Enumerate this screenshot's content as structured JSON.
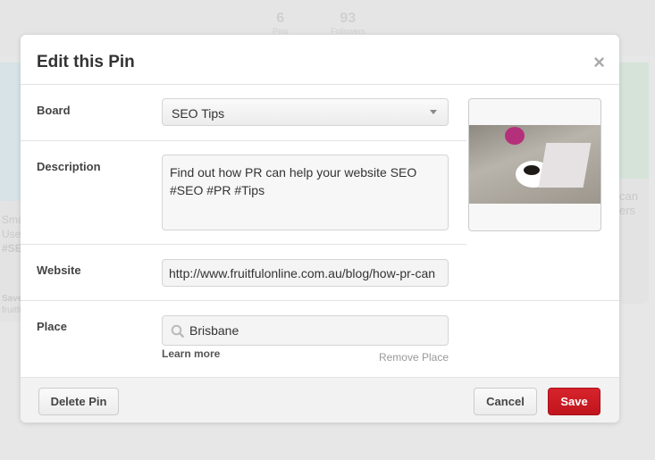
{
  "background": {
    "stats": [
      {
        "value": "6",
        "label": "Pins"
      },
      {
        "value": "93",
        "label": "Followers"
      }
    ],
    "left_card_text": [
      "Sma",
      "Use",
      "#SE"
    ],
    "left_card_save": "Save",
    "left_card_source": "fruitfu",
    "right_card_text": [
      "can",
      "ers"
    ]
  },
  "modal": {
    "title": "Edit this Pin",
    "close_label": "×",
    "board": {
      "label": "Board",
      "value": "SEO Tips"
    },
    "description": {
      "label": "Description",
      "value": "Find out how PR can help your website SEO #SEO #PR #Tips"
    },
    "website": {
      "label": "Website",
      "value": "http://www.fruitfulonline.com.au/blog/how-pr-can"
    },
    "place": {
      "label": "Place",
      "value": "Brisbane",
      "learn_more": "Learn more",
      "remove": "Remove Place"
    },
    "footer": {
      "delete": "Delete Pin",
      "cancel": "Cancel",
      "save": "Save"
    },
    "colors": {
      "save": "#c8161e"
    }
  }
}
